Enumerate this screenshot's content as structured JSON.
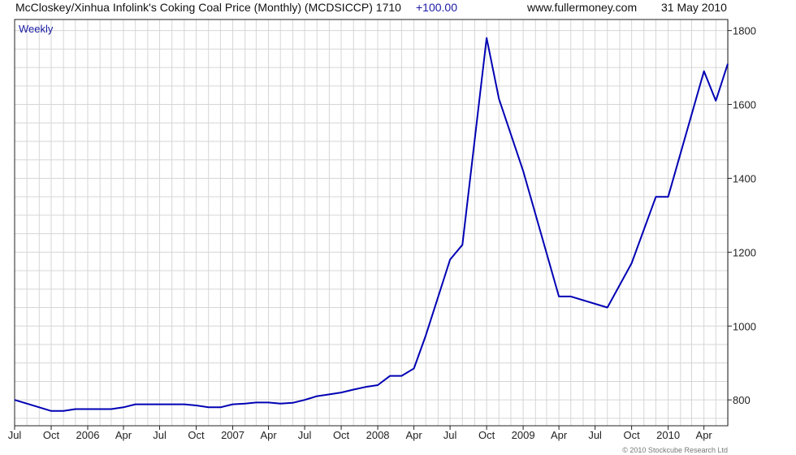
{
  "header": {
    "title": "McCloskey/Xinhua Infolink's Coking Coal Price (Monthly) (MCDSICCP) 1710",
    "change": "+100.00",
    "site": "www.fullermoney.com",
    "date": "31 May 2010"
  },
  "footer": {
    "copyright": "© 2010 Stockcube Research Ltd"
  },
  "colors": {
    "line": "#0000b4",
    "grid": "#d6d6d6",
    "frame": "#222222",
    "label_accent": "#1a1aa6"
  },
  "chart_data": {
    "type": "line",
    "title": "McCloskey/Xinhua Infolink's Coking Coal Price (Monthly) (MCDSICCP) 1710",
    "label": "Weekly",
    "ylim": [
      730,
      1830
    ],
    "y_ticks": [
      800,
      1000,
      1200,
      1400,
      1600,
      1800
    ],
    "x_tick_labels": [
      "Jul",
      "Oct",
      "2006",
      "Apr",
      "Jul",
      "Oct",
      "2007",
      "Apr",
      "Jul",
      "Oct",
      "2008",
      "Apr",
      "Jul",
      "Oct",
      "2009",
      "Apr",
      "Jul",
      "Oct",
      "2010",
      "Apr"
    ],
    "x_range": [
      "2005-07-01",
      "2010-05-31"
    ],
    "grid": true,
    "series": [
      {
        "points": [
          [
            "2005-07-01",
            800
          ],
          [
            "2005-09-01",
            780
          ],
          [
            "2005-10-01",
            770
          ],
          [
            "2005-11-01",
            770
          ],
          [
            "2005-12-01",
            775
          ],
          [
            "2006-01-01",
            775
          ],
          [
            "2006-02-01",
            775
          ],
          [
            "2006-03-01",
            775
          ],
          [
            "2006-04-01",
            780
          ],
          [
            "2006-05-01",
            788
          ],
          [
            "2006-06-01",
            788
          ],
          [
            "2006-07-01",
            788
          ],
          [
            "2006-08-01",
            788
          ],
          [
            "2006-09-01",
            788
          ],
          [
            "2006-10-01",
            785
          ],
          [
            "2006-11-01",
            780
          ],
          [
            "2006-12-01",
            780
          ],
          [
            "2007-01-01",
            788
          ],
          [
            "2007-02-01",
            790
          ],
          [
            "2007-03-01",
            793
          ],
          [
            "2007-04-01",
            793
          ],
          [
            "2007-05-01",
            790
          ],
          [
            "2007-06-01",
            792
          ],
          [
            "2007-07-01",
            800
          ],
          [
            "2007-08-01",
            810
          ],
          [
            "2007-09-01",
            815
          ],
          [
            "2007-10-01",
            820
          ],
          [
            "2007-11-01",
            828
          ],
          [
            "2007-12-01",
            835
          ],
          [
            "2008-01-01",
            840
          ],
          [
            "2008-02-01",
            865
          ],
          [
            "2008-03-01",
            865
          ],
          [
            "2008-04-01",
            885
          ],
          [
            "2008-05-01",
            975
          ],
          [
            "2008-07-01",
            1180
          ],
          [
            "2008-08-01",
            1220
          ],
          [
            "2008-10-01",
            1780
          ],
          [
            "2008-11-01",
            1615
          ],
          [
            "2009-01-01",
            1420
          ],
          [
            "2009-04-01",
            1080
          ],
          [
            "2009-05-01",
            1080
          ],
          [
            "2009-08-01",
            1050
          ],
          [
            "2009-10-01",
            1170
          ],
          [
            "2009-12-01",
            1350
          ],
          [
            "2010-01-01",
            1350
          ],
          [
            "2010-04-01",
            1690
          ],
          [
            "2010-05-01",
            1610
          ],
          [
            "2010-05-31",
            1710
          ]
        ]
      }
    ]
  }
}
